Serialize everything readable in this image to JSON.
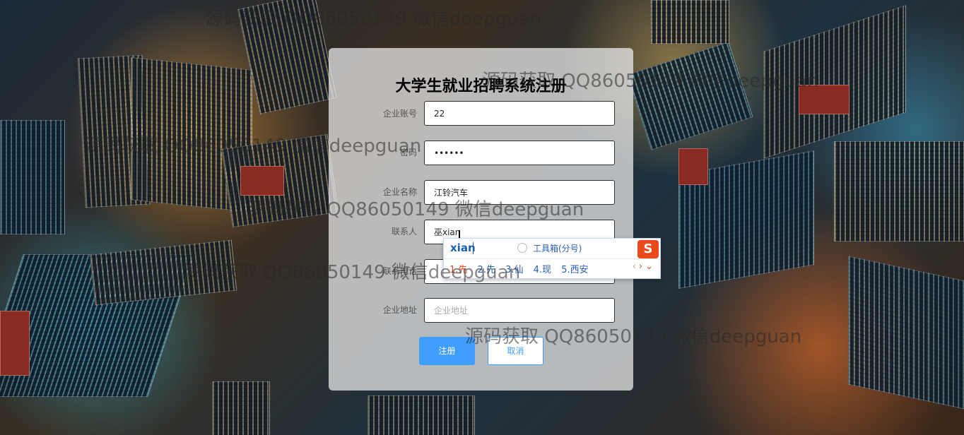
{
  "form": {
    "title": "大学生就业招聘系统注册",
    "fields": [
      {
        "label": "企业账号",
        "value": "22",
        "placeholder": ""
      },
      {
        "label": "密码",
        "value": "••••••",
        "placeholder": ""
      },
      {
        "label": "企业名称",
        "value": "江铃汽车",
        "placeholder": ""
      },
      {
        "label": "联系人",
        "value": "巫xian",
        "placeholder": ""
      },
      {
        "label": "联系电话",
        "value": "",
        "placeholder": ""
      },
      {
        "label": "企业地址",
        "value": "",
        "placeholder": "企业地址"
      }
    ],
    "register_label": "注册",
    "cancel_label": "取消",
    "accent_color": "#409eff"
  },
  "ime": {
    "composition": "xian",
    "toolbox_label": "工具箱(分号)",
    "logo": "S",
    "candidates": [
      "1.先",
      "2.先",
      "3.仙",
      "4.现",
      "5.西安"
    ],
    "nav_prev": "‹",
    "nav_next": "›",
    "nav_expand": "⌄"
  },
  "watermarks": [
    "源码获取 QQ86050149 微信deepguan",
    "源码获取 QQ86050149 微信deepguan",
    "源码获取 QQ86050149 微信deepguan",
    "源码获取 QQ86050149 微信deepguan",
    "源码获取 QQ86050149 微信deepguan",
    "源码获取 QQ86050149 微信deepguan"
  ]
}
